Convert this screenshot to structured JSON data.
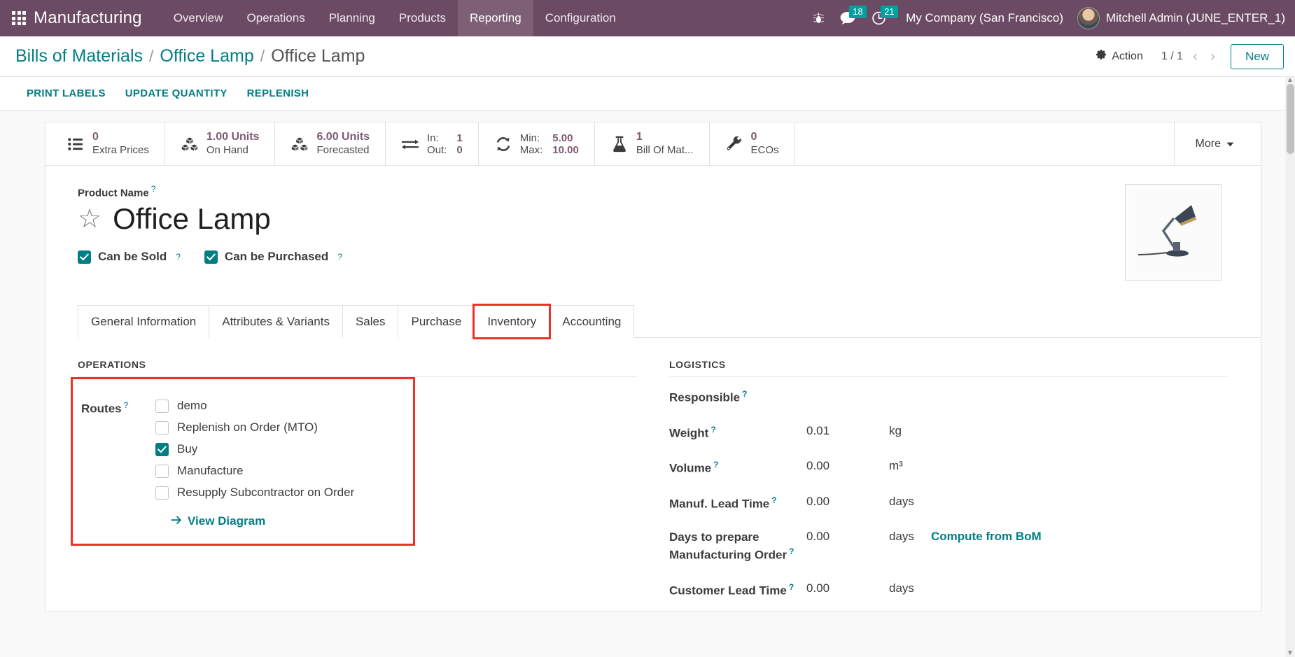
{
  "navbar": {
    "apps_icon": "apps-grid-icon",
    "brand": "Manufacturing",
    "menus": [
      {
        "label": "Overview",
        "active": false
      },
      {
        "label": "Operations",
        "active": false
      },
      {
        "label": "Planning",
        "active": false
      },
      {
        "label": "Products",
        "active": false
      },
      {
        "label": "Reporting",
        "active": true
      },
      {
        "label": "Configuration",
        "active": false
      }
    ],
    "debug_icon": "bug-icon",
    "messages_icon": "chat-bubble-icon",
    "messages_count": "18",
    "activities_icon": "clock-icon",
    "activities_count": "21",
    "company": "My Company (San Francisco)",
    "user": "Mitchell Admin (JUNE_ENTER_1)",
    "accent": "#6b4a63",
    "badge_color": "#00a09d"
  },
  "control_panel": {
    "breadcrumb": [
      {
        "label": "Bills of Materials",
        "current": false
      },
      {
        "label": "Office Lamp",
        "current": false
      },
      {
        "label": "Office Lamp",
        "current": true
      }
    ],
    "separator": "/",
    "action_label": "Action",
    "action_icon": "gear-icon",
    "pager": "1 / 1",
    "prev_icon": "chevron-left-icon",
    "next_icon": "chevron-right-icon",
    "new_label": "New",
    "link_color": "#017e84"
  },
  "action_bar": {
    "buttons": [
      {
        "label": "PRINT LABELS"
      },
      {
        "label": "UPDATE QUANTITY"
      },
      {
        "label": "REPLENISH"
      }
    ]
  },
  "stat_buttons": [
    {
      "icon": "list-icon",
      "value": "0",
      "label": "Extra Prices"
    },
    {
      "icon": "boxes-icon",
      "value": "1.00 Units",
      "label": "On Hand"
    },
    {
      "icon": "boxes-icon",
      "value": "6.00 Units",
      "label": "Forecasted"
    },
    {
      "icon": "exchange-icon",
      "rows": [
        {
          "k": "In:",
          "v": "1"
        },
        {
          "k": "Out:",
          "v": "0"
        }
      ]
    },
    {
      "icon": "refresh-icon",
      "rows": [
        {
          "k": "Min:",
          "v": "5.00"
        },
        {
          "k": "Max:",
          "v": "10.00"
        }
      ]
    },
    {
      "icon": "flask-icon",
      "value": "1",
      "label": "Bill Of Mat..."
    },
    {
      "icon": "wrench-icon",
      "value": "0",
      "label": "ECOs"
    }
  ],
  "more_button": {
    "label": "More",
    "icon": "caret-down-icon"
  },
  "product": {
    "name_label": "Product Name",
    "name": "Office Lamp",
    "favorite_icon": "star-outline-icon",
    "image_icon": "office-lamp-photo",
    "flags": [
      {
        "label": "Can be Sold",
        "checked": true
      },
      {
        "label": "Can be Purchased",
        "checked": true
      }
    ]
  },
  "tabs": [
    {
      "label": "General Information",
      "active": false
    },
    {
      "label": "Attributes & Variants",
      "active": false
    },
    {
      "label": "Sales",
      "active": false
    },
    {
      "label": "Purchase",
      "active": false
    },
    {
      "label": "Inventory",
      "active": true
    },
    {
      "label": "Accounting",
      "active": false
    }
  ],
  "operations": {
    "group_title": "OPERATIONS",
    "routes_label": "Routes",
    "routes": [
      {
        "label": "demo",
        "checked": false
      },
      {
        "label": "Replenish on Order (MTO)",
        "checked": false
      },
      {
        "label": "Buy",
        "checked": true
      },
      {
        "label": "Manufacture",
        "checked": false
      },
      {
        "label": "Resupply Subcontractor on Order",
        "checked": false
      }
    ],
    "view_diagram": "View Diagram",
    "view_diagram_icon": "arrow-right-icon",
    "highlight_color": "#ef3124"
  },
  "logistics": {
    "group_title": "LOGISTICS",
    "fields": [
      {
        "label": "Responsible",
        "value": "",
        "unit": "",
        "link": "",
        "avatar": true
      },
      {
        "label": "Weight",
        "value": "0.01",
        "unit": "kg",
        "link": ""
      },
      {
        "label": "Volume",
        "value": "0.00",
        "unit": "m³",
        "link": ""
      },
      {
        "label": "Manuf. Lead Time",
        "value": "0.00",
        "unit": "days",
        "link": ""
      },
      {
        "label": "Days to prepare Manufacturing Order",
        "value": "0.00",
        "unit": "days",
        "link": "Compute from BoM"
      },
      {
        "label": "Customer Lead Time",
        "value": "0.00",
        "unit": "days",
        "link": ""
      }
    ]
  },
  "help_marker": "?"
}
